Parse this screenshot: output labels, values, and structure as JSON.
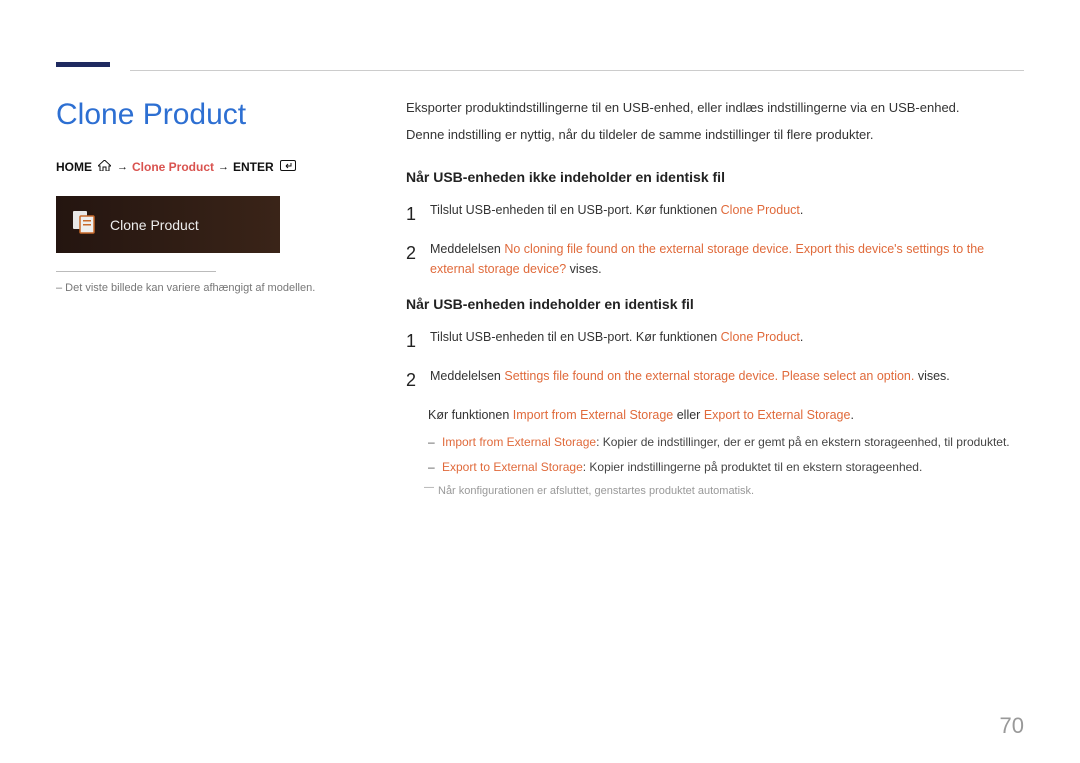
{
  "title": "Clone Product",
  "breadcrumb": {
    "home": "HOME",
    "clone": "Clone Product",
    "enter": "ENTER"
  },
  "tile": {
    "label": "Clone Product"
  },
  "caption": "–   Det viste billede kan variere afhængigt af modellen.",
  "intro": {
    "line1": "Eksporter produktindstillingerne til en USB-enhed, eller indlæs indstillingerne via en USB-enhed.",
    "line2": "Denne indstilling er nyttig, når du tildeler de samme indstillinger til flere produkter."
  },
  "section1": {
    "heading": "Når USB-enheden ikke indeholder en identisk fil",
    "step1": {
      "pre": "Tilslut USB-enheden til en USB-port. Kør funktionen ",
      "func": "Clone Product",
      "post": "."
    },
    "step2": {
      "pre": "Meddelelsen ",
      "msg": "No cloning file found on the external storage device. Export this device's settings to the external storage device?",
      "post": " vises."
    }
  },
  "section2": {
    "heading": "Når USB-enheden indeholder en identisk fil",
    "step1": {
      "pre": "Tilslut USB-enheden til en USB-port. Kør funktionen ",
      "func": "Clone Product",
      "post": "."
    },
    "step2": {
      "pre": "Meddelelsen ",
      "msg": "Settings file found on the external storage device. Please select an option.",
      "post": " vises."
    },
    "funcNote": {
      "pre": "Kør funktionen ",
      "f1": "Import from External Storage",
      "mid": " eller ",
      "f2": "Export to External Storage",
      "post": "."
    },
    "bullet1": {
      "label": "Import from External Storage",
      "text": ": Kopier de indstillinger, der er gemt på en ekstern storageenhed, til produktet."
    },
    "bullet2": {
      "label": "Export to External Storage",
      "text": ": Kopier indstillingerne på produktet til en ekstern storageenhed."
    },
    "footnote": "Når konfigurationen er afsluttet, genstartes produktet automatisk."
  },
  "pageNumber": "70"
}
